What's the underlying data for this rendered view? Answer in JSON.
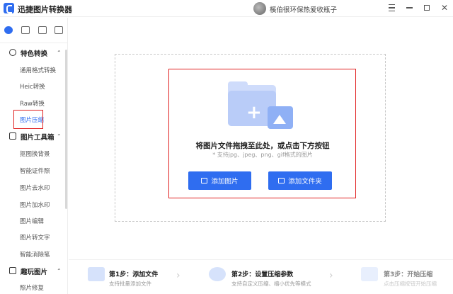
{
  "app": {
    "title": "迅捷图片转换器",
    "username": "榽伯很环保热爱收瓶子"
  },
  "sidebar": {
    "groups": [
      {
        "label": "特色转换",
        "items": [
          "通用格式转换",
          "Heic转换",
          "Raw转换",
          "图片压缩"
        ]
      },
      {
        "label": "图片工具箱",
        "items": [
          "抠图换背景",
          "智能证件照",
          "图片去水印",
          "图片加水印",
          "图片编辑",
          "图片转文字",
          "智能消除笔"
        ]
      },
      {
        "label": "趣玩图片",
        "items": [
          "照片修复"
        ]
      }
    ],
    "selected_item": "图片压缩"
  },
  "dropzone": {
    "title": "将图片文件拖拽至此处，或点击下方按钮",
    "hint": "* 支持jpg、jpeg、png、gif格式的图片",
    "add_image_button": "添加图片",
    "add_folder_button": "添加文件夹"
  },
  "steps": [
    {
      "title": "第1步：添加文件",
      "subtitle": "支持批量添加文件"
    },
    {
      "title": "第2步：设置压缩参数",
      "subtitle": "支持自定义压缩、缩小优先等模式"
    },
    {
      "title": "第3步：开始压缩",
      "subtitle": "点击压缩按钮开始压缩"
    }
  ],
  "colors": {
    "accent": "#2f6df0",
    "highlight_box": "#e02020"
  }
}
